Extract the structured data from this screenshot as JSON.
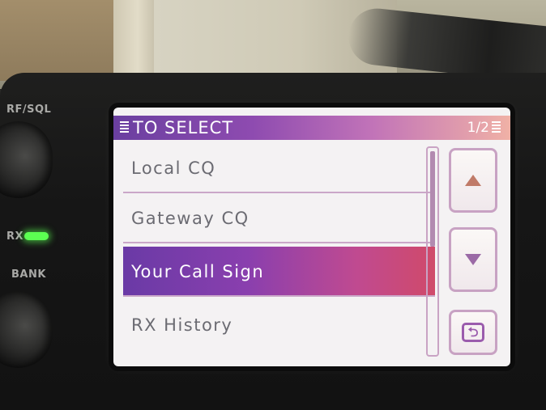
{
  "screen": {
    "title": "TO SELECT",
    "page": "1/2",
    "items": [
      {
        "label": "Local CQ",
        "selected": false
      },
      {
        "label": "Gateway CQ",
        "selected": false
      },
      {
        "label": "Your Call Sign",
        "selected": true
      },
      {
        "label": "RX History",
        "selected": false
      }
    ],
    "buttons": {
      "up_icon": "triangle-up-icon",
      "down_icon": "triangle-down-icon",
      "back_icon": "return-arrow-icon",
      "back_glyph": "⮌"
    }
  },
  "panel": {
    "rf_sql_label": "RF/SQL",
    "bank_label": "BANK",
    "rx_label": "RX"
  },
  "colors": {
    "title_gradient_start": "#6a3fa0",
    "title_gradient_end": "#f0b1a6",
    "selected_row": "#8a3fae",
    "led_green": "#5cff52"
  }
}
